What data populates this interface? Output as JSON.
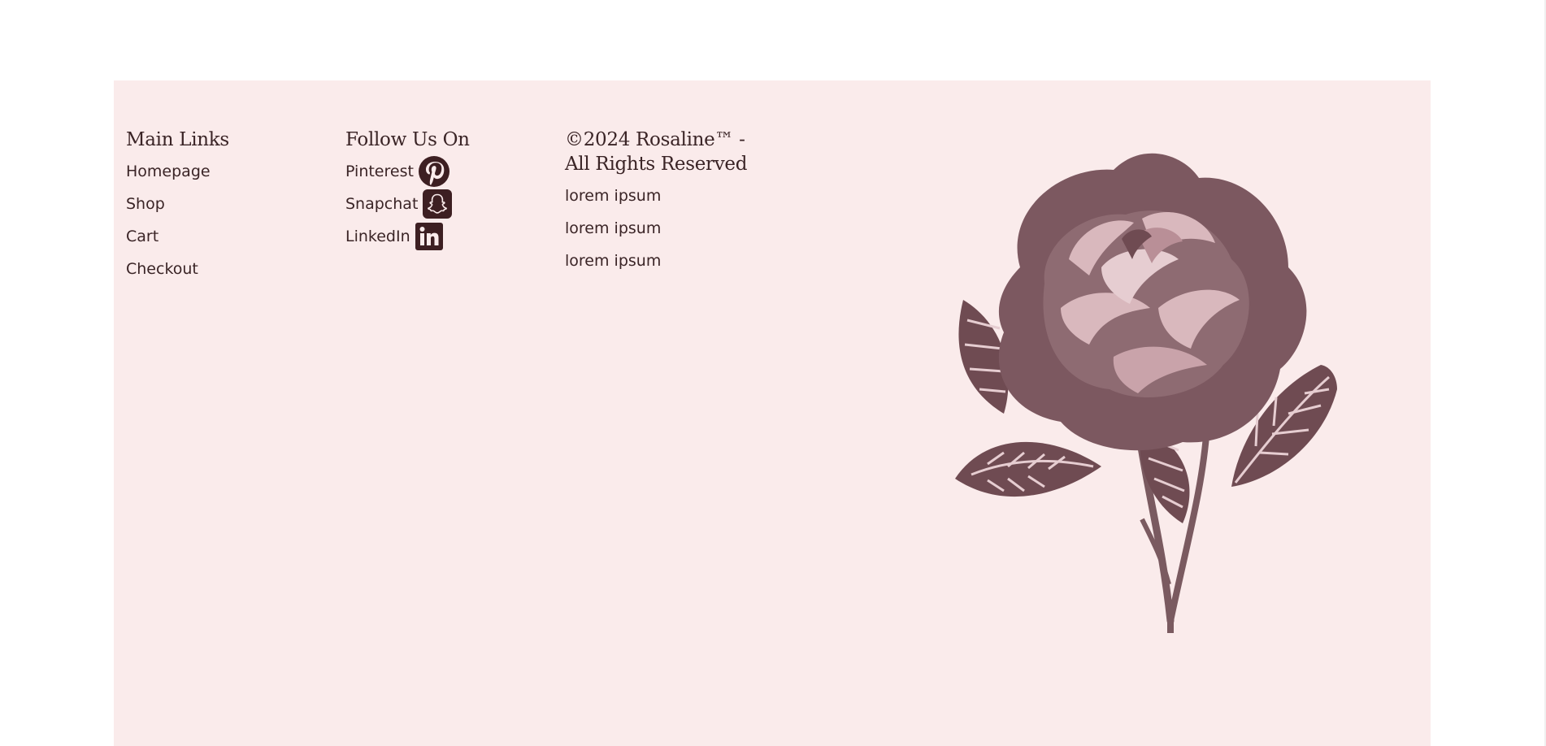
{
  "footer": {
    "main_links": {
      "heading": "Main Links",
      "items": [
        "Homepage",
        "Shop",
        "Cart",
        "Checkout"
      ]
    },
    "follow": {
      "heading": "Follow Us On",
      "items": [
        {
          "label": "Pinterest",
          "icon": "pinterest-icon"
        },
        {
          "label": "Snapchat",
          "icon": "snapchat-icon"
        },
        {
          "label": "LinkedIn",
          "icon": "linkedin-icon"
        }
      ]
    },
    "copyright": {
      "heading_line1": "©2024 Rosaline™ -",
      "heading_line2": "All Rights Reserved",
      "items": [
        "lorem ipsum",
        "lorem ipsum",
        "lorem ipsum"
      ]
    },
    "decoration": "rose-illustration"
  },
  "colors": {
    "footer_bg": "#faebeb",
    "text": "#3a2426",
    "icon": "#3d1f22",
    "rose_dark": "#6f4b52",
    "rose_light": "#d9b8bd"
  }
}
